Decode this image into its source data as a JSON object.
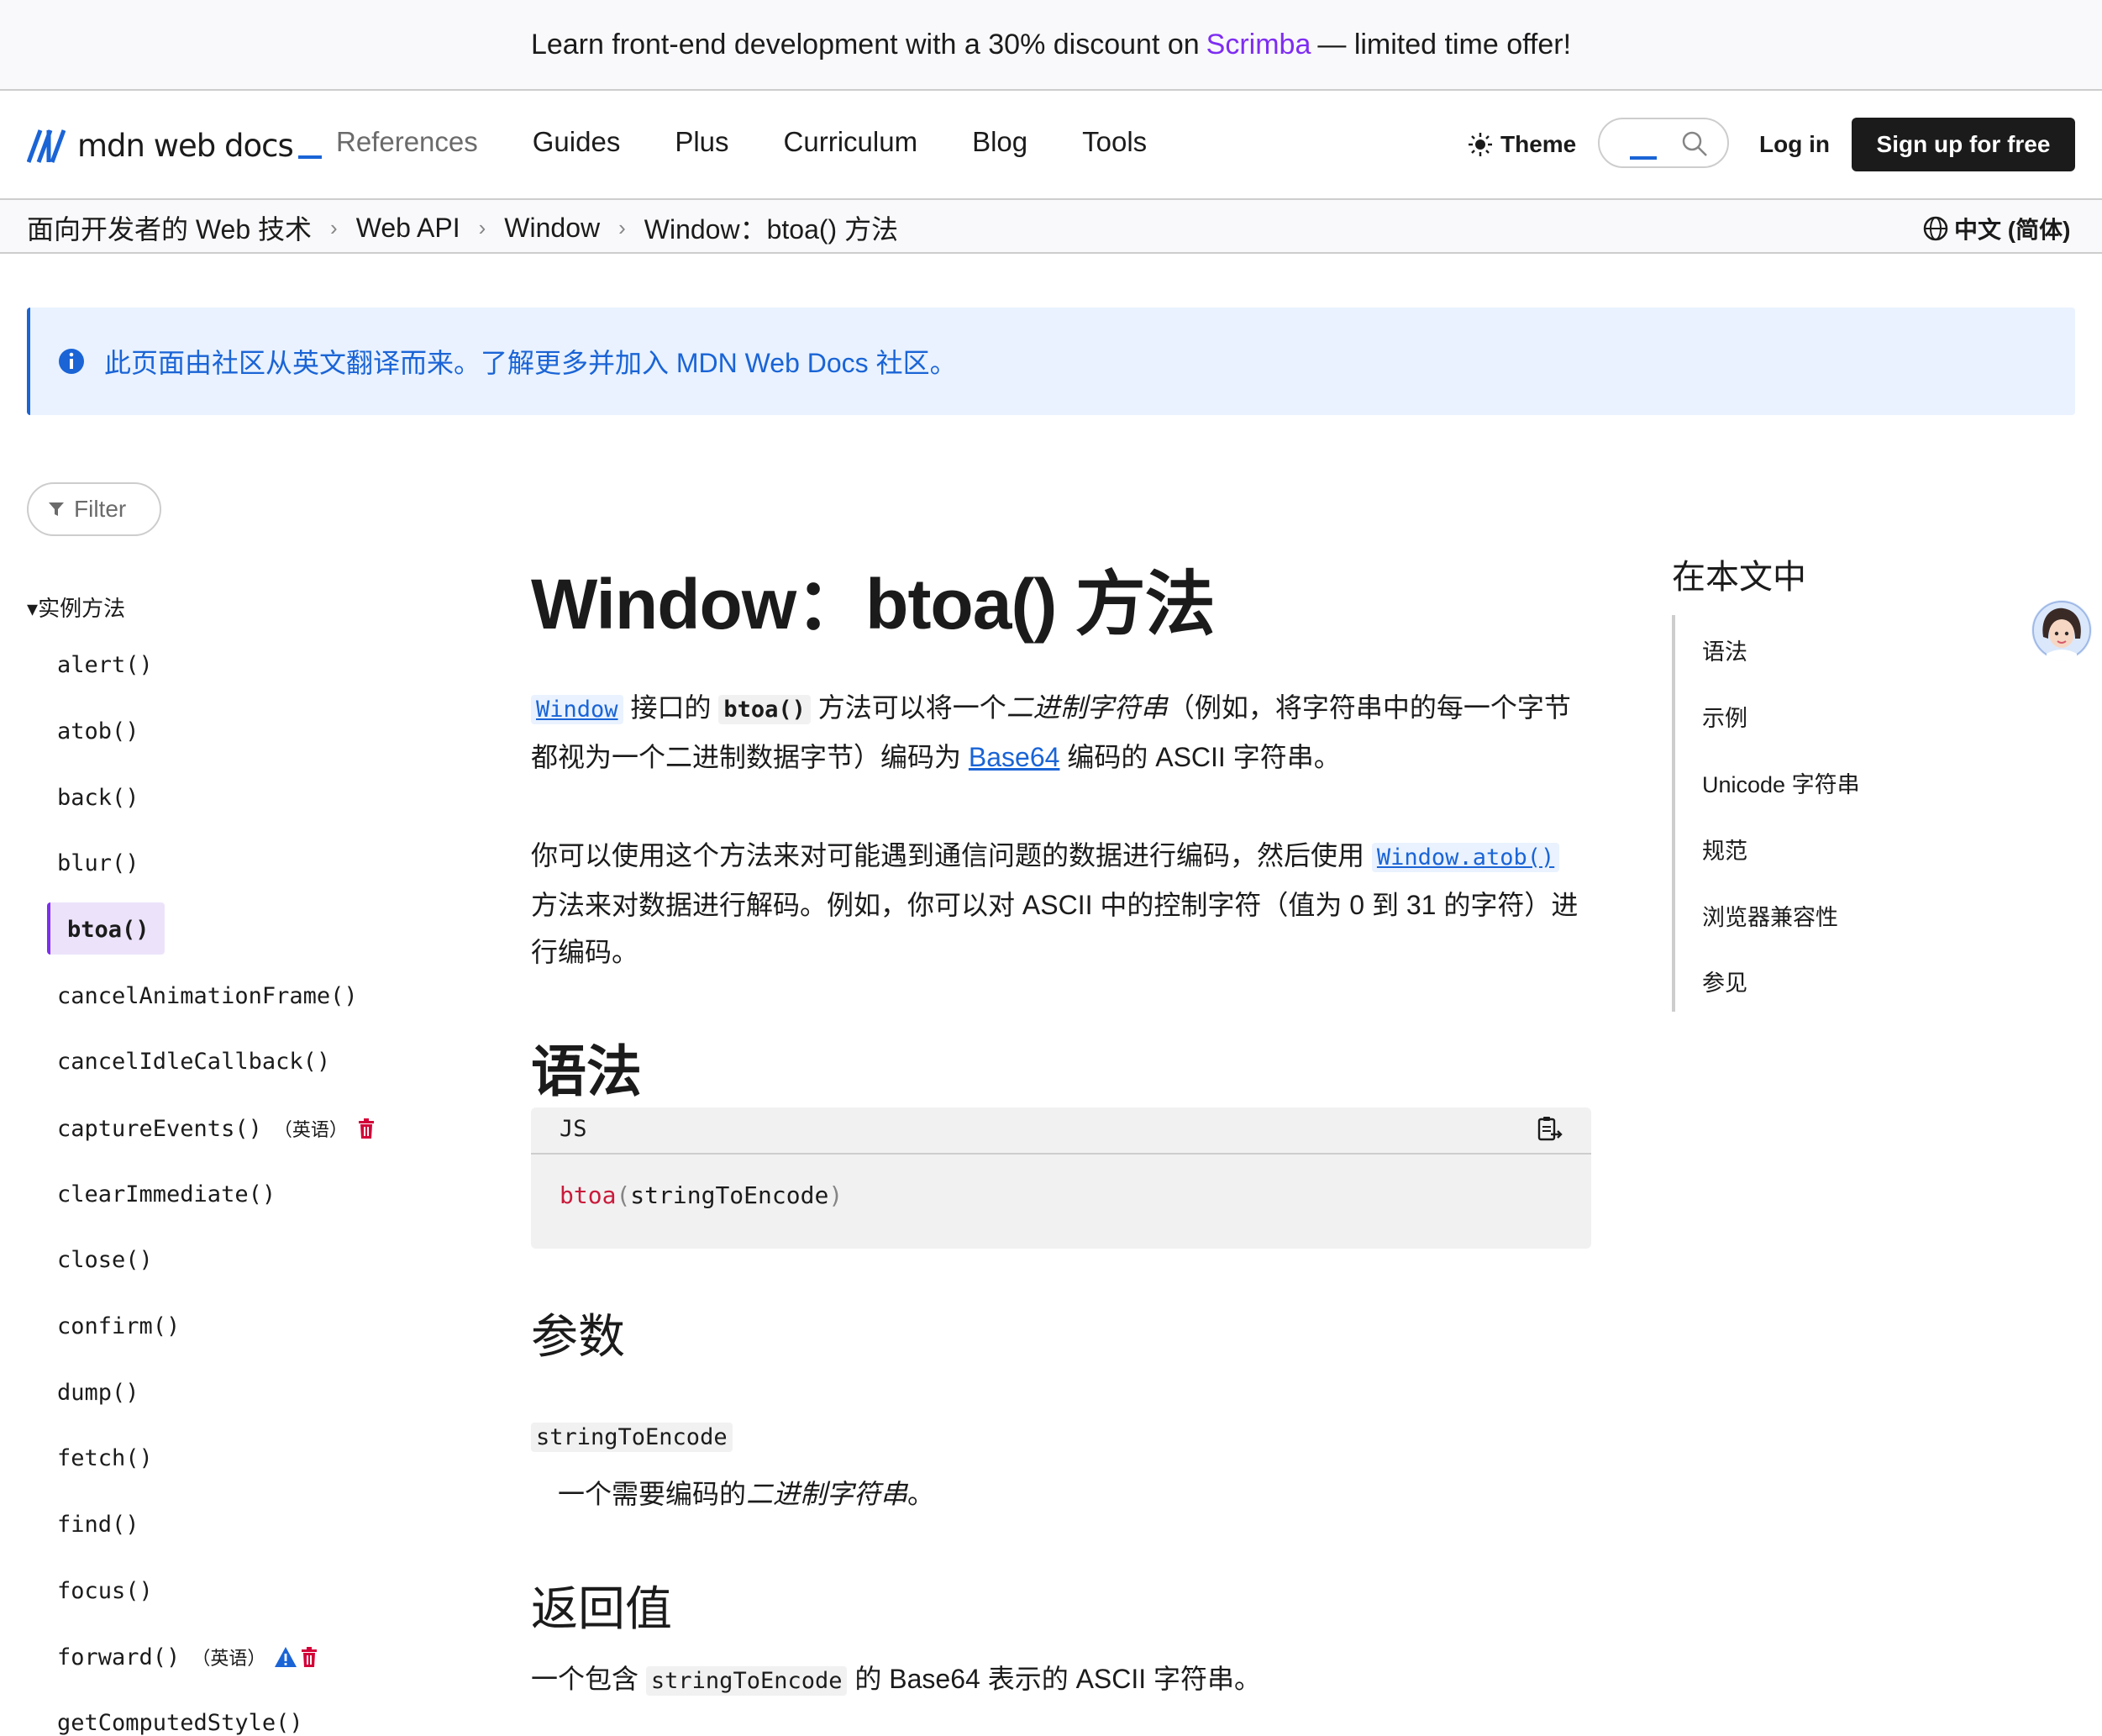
{
  "banner": {
    "prefix": "Learn front-end development with a 30% discount on",
    "link": "Scrimba",
    "suffix": "— limited time offer!"
  },
  "header": {
    "logo_text": "mdn web docs",
    "nav": [
      "References",
      "Guides",
      "Plus",
      "Curriculum",
      "Blog",
      "Tools"
    ],
    "theme_label": "Theme",
    "login_label": "Log in",
    "signup_label": "Sign up for free"
  },
  "breadcrumb": {
    "items": [
      "面向开发者的 Web 技术",
      "Web API",
      "Window",
      "Window：btoa() 方法"
    ],
    "language": "中文 (简体)"
  },
  "notice": {
    "text": "此页面由社区从英文翻译而来。了解更多并加入 MDN Web Docs 社区。"
  },
  "sidebar": {
    "filter_label": "Filter",
    "section_title": "实例方法",
    "items": [
      {
        "label": "alert()",
        "note": ""
      },
      {
        "label": "atob()",
        "note": ""
      },
      {
        "label": "back()",
        "note": ""
      },
      {
        "label": "blur()",
        "note": ""
      },
      {
        "label": "btoa()",
        "note": ""
      },
      {
        "label": "cancelAnimationFrame()",
        "note": ""
      },
      {
        "label": "cancelIdleCallback()",
        "note": ""
      },
      {
        "label": "captureEvents()",
        "note": "（英语）"
      },
      {
        "label": "clearImmediate()",
        "note": ""
      },
      {
        "label": "close()",
        "note": ""
      },
      {
        "label": "confirm()",
        "note": ""
      },
      {
        "label": "dump()",
        "note": ""
      },
      {
        "label": "fetch()",
        "note": ""
      },
      {
        "label": "find()",
        "note": ""
      },
      {
        "label": "focus()",
        "note": ""
      },
      {
        "label": "forward()",
        "note": "（英语）"
      },
      {
        "label": "getComputedStyle()",
        "note": ""
      }
    ]
  },
  "article": {
    "title": "Window：btoa() 方法",
    "p1": {
      "code_link": "Window",
      "t1": " 接口的 ",
      "code": "btoa()",
      "t2": " 方法可以将一个",
      "em": "二进制字符串",
      "t3": "（例如，将字符串中的每一个字节都视为一个二进制数据字节）编码为 ",
      "link": "Base64",
      "t4": " 编码的 ASCII 字符串。"
    },
    "p2": {
      "t1": "你可以使用这个方法来对可能遇到通信问题的数据进行编码，然后使用 ",
      "code_link": "Window.atob()",
      "t2": " 方法来对数据进行解码。例如，你可以对 ASCII 中的控制字符（值为 0 到 31 的字符）进行编码。"
    },
    "syntax_heading": "语法",
    "code_lang": "JS",
    "code_fn": "btoa",
    "code_open": "(",
    "code_arg": "stringToEncode",
    "code_close": ")",
    "params_heading": "参数",
    "param_name": "stringToEncode",
    "param_desc_prefix": "一个需要编码的",
    "param_desc_em": "二进制字符串",
    "param_desc_suffix": "。",
    "return_heading": "返回值",
    "return_prefix": "一个包含 ",
    "return_code": "stringToEncode",
    "return_suffix": " 的 Base64 表示的 ASCII 字符串。"
  },
  "toc": {
    "title": "在本文中",
    "items": [
      "语法",
      "示例",
      "Unicode 字符串",
      "规范",
      "浏览器兼容性",
      "参见"
    ]
  },
  "colors": {
    "accent": "#1a64d6",
    "purple": "#7e2df2",
    "deprecated": "#d30038",
    "code_fn": "#c91a3b"
  }
}
